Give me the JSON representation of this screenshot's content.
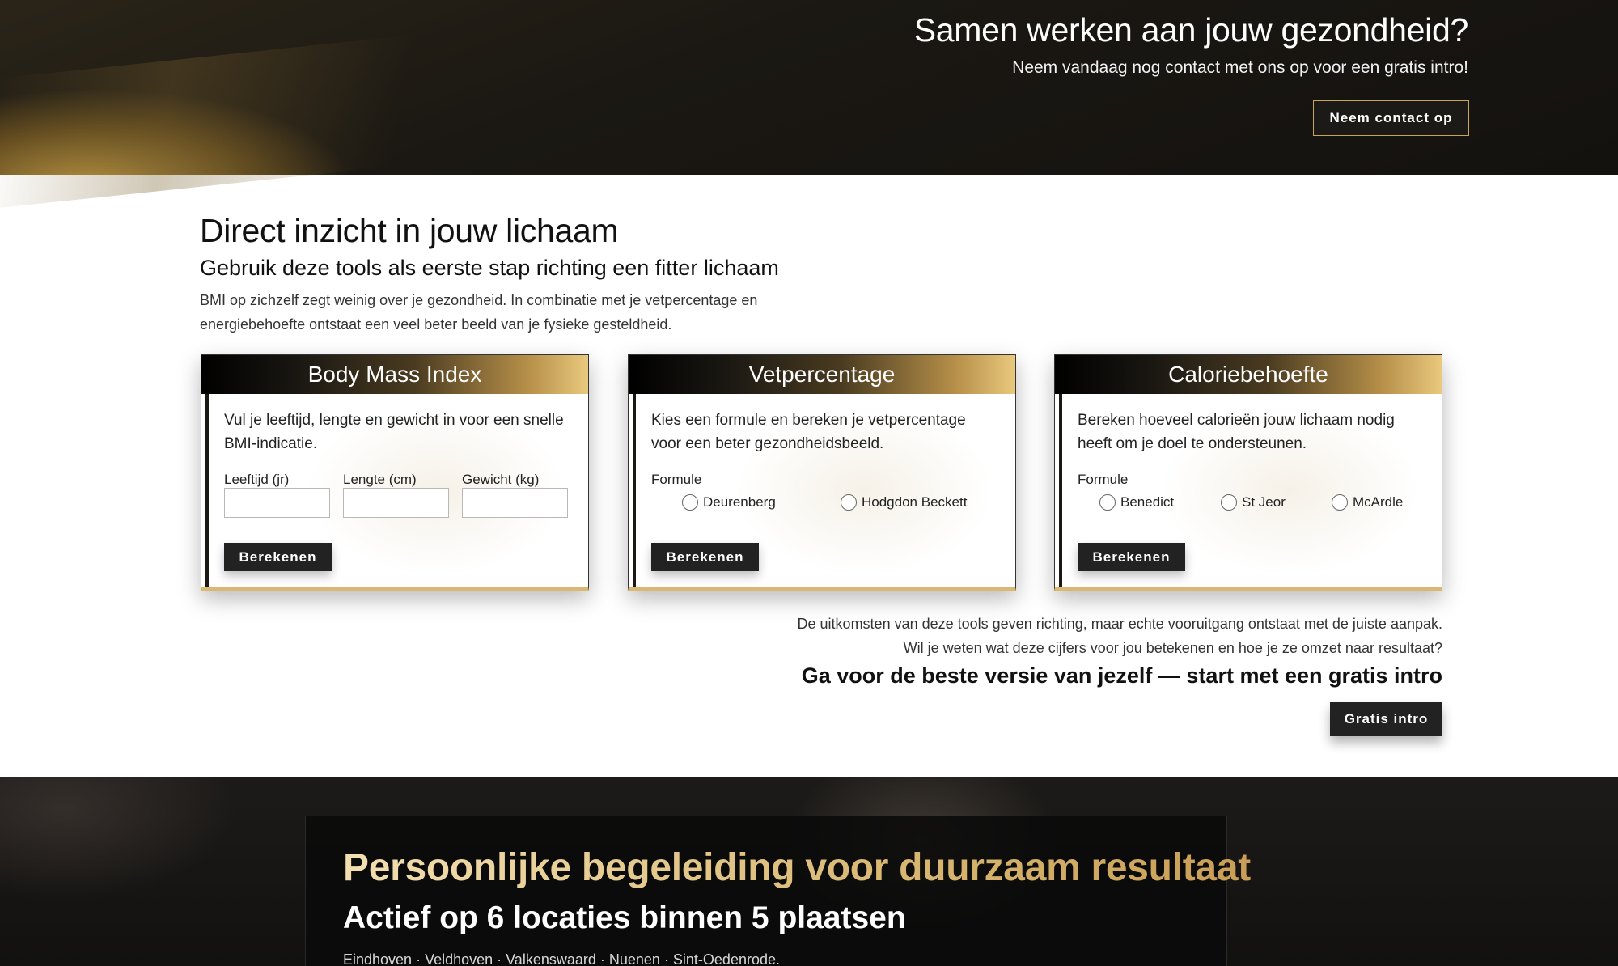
{
  "hero": {
    "title": "Samen werken aan jouw gezondheid?",
    "subtitle": "Neem vandaag nog contact met ons op voor een gratis intro!",
    "button_label": "Neem contact op"
  },
  "tools": {
    "title": "Direct inzicht in jouw lichaam",
    "subtitle": "Gebruik deze tools als eerste stap richting een fitter lichaam",
    "description": "BMI op zichzelf zegt weinig over je gezondheid. In combinatie met je vetpercentage en energiebehoefte ontstaat een veel beter beeld van je fysieke gesteldheid.",
    "cards": [
      {
        "title": "Body Mass Index",
        "text": "Vul je leeftijd, lengte en gewicht in voor een snelle BMI-indicatie.",
        "fields": [
          {
            "label": "Leeftijd (jr)",
            "value": ""
          },
          {
            "label": "Lengte (cm)",
            "value": ""
          },
          {
            "label": "Gewicht (kg)",
            "value": ""
          }
        ],
        "button_label": "Berekenen"
      },
      {
        "title": "Vetpercentage",
        "text": "Kies een formule en bereken je vetpercentage voor een beter gezondheidsbeeld.",
        "formula_label": "Formule",
        "options": [
          "Deurenberg",
          "Hodgdon Beckett"
        ],
        "button_label": "Berekenen"
      },
      {
        "title": "Caloriebehoefte",
        "text": "Bereken hoeveel calorieën jouw lichaam nodig heeft om je doel te ondersteunen.",
        "formula_label": "Formule",
        "options": [
          "Benedict",
          "St Jeor",
          "McArdle"
        ],
        "button_label": "Berekenen"
      }
    ],
    "outro": "De uitkomsten van deze tools geven richting, maar echte vooruitgang ontstaat met de juiste aanpak. Wil je weten wat deze cijfers voor jou betekenen en hoe je ze omzet naar resultaat?",
    "cta": "Ga voor de beste versie van jezelf — start met een gratis intro",
    "cta_button_label": "Gratis intro"
  },
  "coaching": {
    "title": "Persoonlijke begeleiding voor duurzaam resultaat",
    "subtitle": "Actief op 6 locaties binnen 5 plaatsen",
    "locations": "Eindhoven · Veldhoven · Valkenswaard · Nuenen · Sint-Oedenrode."
  },
  "colors": {
    "accent_gold": "#d9b873",
    "dark": "#1c1a17",
    "button_dark": "#222222"
  }
}
